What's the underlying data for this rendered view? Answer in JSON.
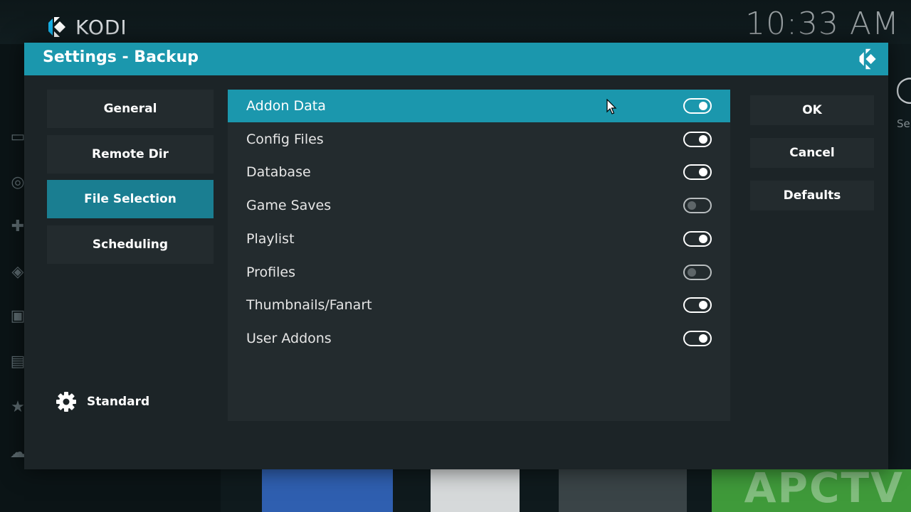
{
  "background": {
    "brand_name": "KODI",
    "clock": "10:33 AM",
    "right_peek_text": "Se",
    "watermark": "APCTV"
  },
  "dialog": {
    "title": "Settings - Backup",
    "header_color": "#1b97ad"
  },
  "categories": [
    {
      "label": "General",
      "active": false
    },
    {
      "label": "Remote Dir",
      "active": false
    },
    {
      "label": "File Selection",
      "active": true
    },
    {
      "label": "Scheduling",
      "active": false
    }
  ],
  "settings_level": {
    "label": "Standard",
    "icon": "gear-icon"
  },
  "settings": [
    {
      "label": "Addon Data",
      "enabled": true,
      "focused": true
    },
    {
      "label": "Config Files",
      "enabled": true,
      "focused": false
    },
    {
      "label": "Database",
      "enabled": true,
      "focused": false
    },
    {
      "label": "Game Saves",
      "enabled": false,
      "focused": false
    },
    {
      "label": "Playlist",
      "enabled": true,
      "focused": false
    },
    {
      "label": "Profiles",
      "enabled": false,
      "focused": false
    },
    {
      "label": "Thumbnails/Fanart",
      "enabled": true,
      "focused": false
    },
    {
      "label": "User Addons",
      "enabled": true,
      "focused": false
    }
  ],
  "actions": {
    "ok": "OK",
    "cancel": "Cancel",
    "defaults": "Defaults"
  },
  "colors": {
    "accent": "#1b97ad",
    "active_category": "#1a7e91",
    "panel": "#232b2e",
    "dialog_bg": "#1c2427"
  }
}
